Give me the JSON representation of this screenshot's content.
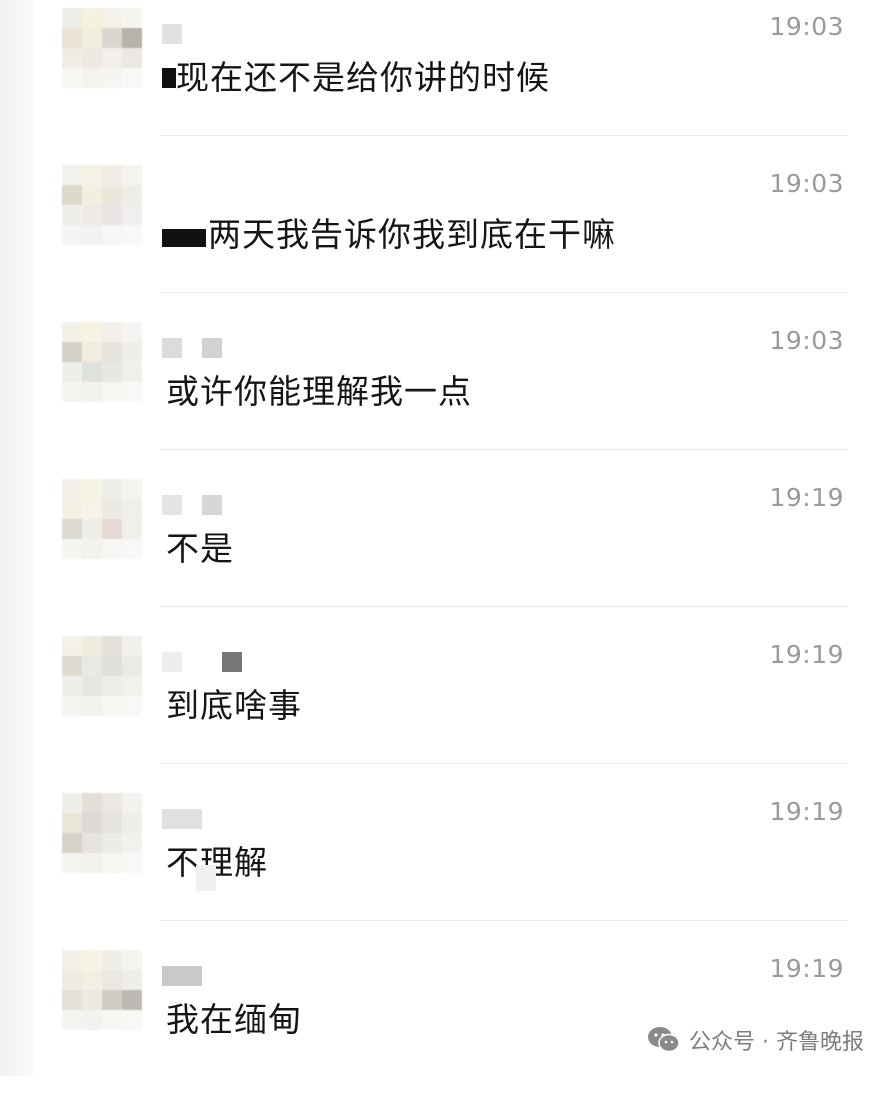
{
  "messages": [
    {
      "time": "19:03",
      "text": "现在还不是给你讲的时候"
    },
    {
      "time": "19:03",
      "text": "两天我告诉你我到底在干嘛"
    },
    {
      "time": "19:03",
      "text": "或许你能理解我一点"
    },
    {
      "time": "19:19",
      "text": "不是"
    },
    {
      "time": "19:19",
      "text": "到底啥事"
    },
    {
      "time": "19:19",
      "text": "不理解"
    },
    {
      "time": "19:19",
      "text": "我在缅甸"
    }
  ],
  "watermark": {
    "text": "公众号 · 齐鲁晚报",
    "icon": "wechat-icon"
  },
  "colors": {
    "time": "#9a9a9a",
    "text": "#151515",
    "divider": "#ececec"
  }
}
